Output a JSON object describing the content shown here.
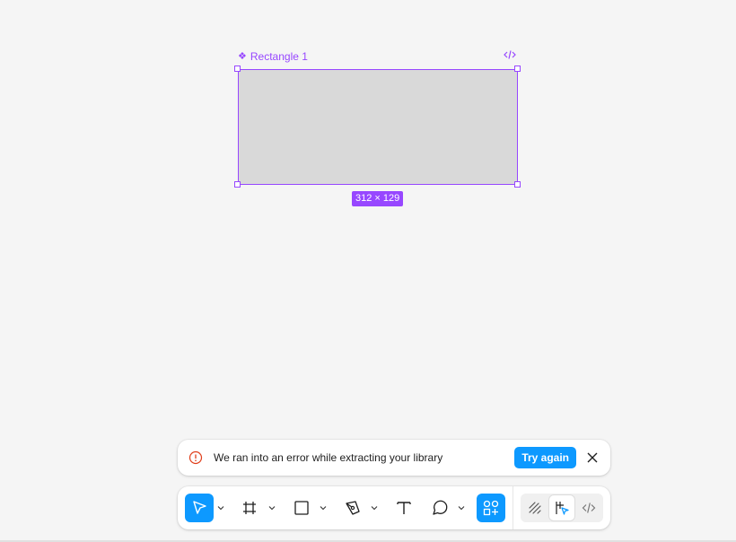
{
  "canvas": {
    "component_icon": "component-icon",
    "component_name": "Rectangle 1",
    "code_icon": "code-icon",
    "dimensions": "312 × 129",
    "rect_fill": "#d9d9d9",
    "selection_color": "#9747ff"
  },
  "toast": {
    "icon": "error-icon",
    "message": "We ran into an error while extracting your library",
    "try_again_label": "Try again",
    "close_icon": "close-icon",
    "accent": "#0d99ff"
  },
  "toolbar": {
    "tools": [
      {
        "name": "move-tool",
        "icon": "cursor-icon",
        "active": true,
        "has_dropdown": true
      },
      {
        "name": "frame-tool",
        "icon": "frame-icon",
        "active": false,
        "has_dropdown": true
      },
      {
        "name": "shape-tool",
        "icon": "rectangle-icon",
        "active": false,
        "has_dropdown": true
      },
      {
        "name": "pen-tool",
        "icon": "pen-icon",
        "active": false,
        "has_dropdown": true
      },
      {
        "name": "text-tool",
        "icon": "text-icon",
        "active": false,
        "has_dropdown": false
      },
      {
        "name": "comment-tool",
        "icon": "comment-icon",
        "active": false,
        "has_dropdown": true
      },
      {
        "name": "assets-tool",
        "icon": "assets-icon",
        "active": true,
        "has_dropdown": false
      }
    ],
    "modes": [
      {
        "name": "draw-mode",
        "icon": "draw-icon",
        "active": false
      },
      {
        "name": "design-mode",
        "icon": "design-icon",
        "active": true
      },
      {
        "name": "dev-mode",
        "icon": "code-icon",
        "active": false
      }
    ]
  }
}
